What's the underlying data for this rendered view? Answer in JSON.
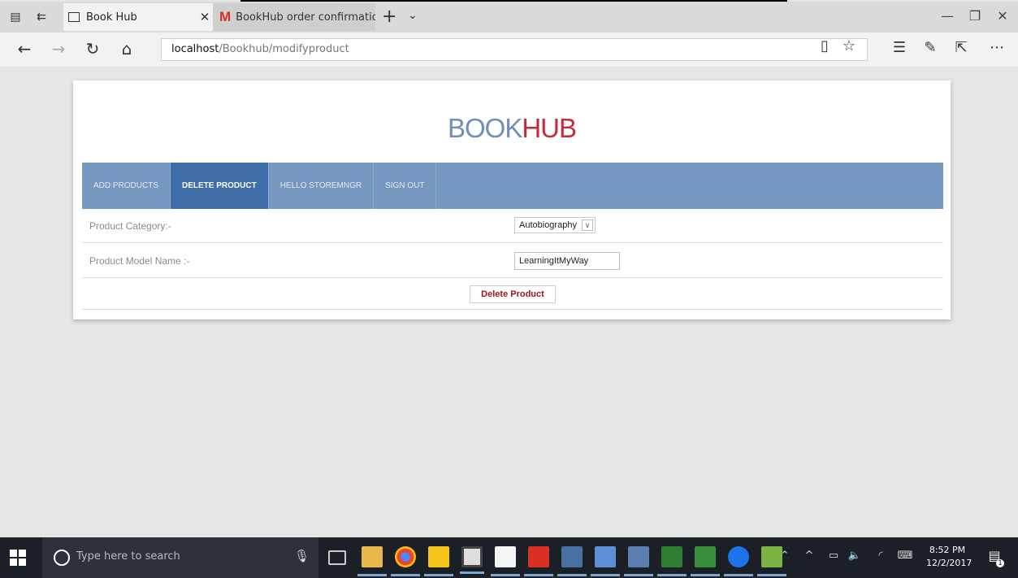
{
  "browser": {
    "tabs": [
      {
        "label": "Book Hub",
        "close": "✕"
      },
      {
        "label": "BookHub order confirmatio",
        "logo": "M"
      }
    ],
    "new_tab": "+",
    "tab_menu": "⌄",
    "url_host": "localhost",
    "url_path": "/Bookhub/modifyproduct",
    "window_controls": {
      "minimize": "—",
      "restore": "❐",
      "close": "✕"
    },
    "icons": [
      "tab-preview-icon",
      "set-aside-icon",
      "back-icon",
      "forward-icon",
      "refresh-icon",
      "home-icon",
      "reading-view-icon",
      "favorite-star-icon",
      "favorites-hub-icon",
      "web-note-icon",
      "share-icon",
      "more-icon"
    ]
  },
  "page": {
    "logo_book": "BOOK",
    "logo_hub": "HUB",
    "menu": [
      {
        "label": "ADD PRODUCTS"
      },
      {
        "label": "DELETE PRODUCT"
      },
      {
        "label": "HELLO STOREMNGR"
      },
      {
        "label": "SIGN OUT"
      }
    ],
    "form": {
      "category_label": "Product Category:-",
      "category_value": "Autobiography",
      "model_label": "Product Model Name :-",
      "model_value": "LearningItMyWay",
      "delete_button": "Delete Product"
    },
    "colors": {
      "logo_book": "#6f8fb8",
      "logo_hub": "#c62b3b",
      "menu_bg": "#7597c0",
      "menu_active": "#3f6ea8",
      "button_text": "#a0151c"
    }
  },
  "taskbar": {
    "search_placeholder": "Type here to search",
    "time": "8:52 PM",
    "date": "12/2/2017",
    "notification_count": "1"
  }
}
